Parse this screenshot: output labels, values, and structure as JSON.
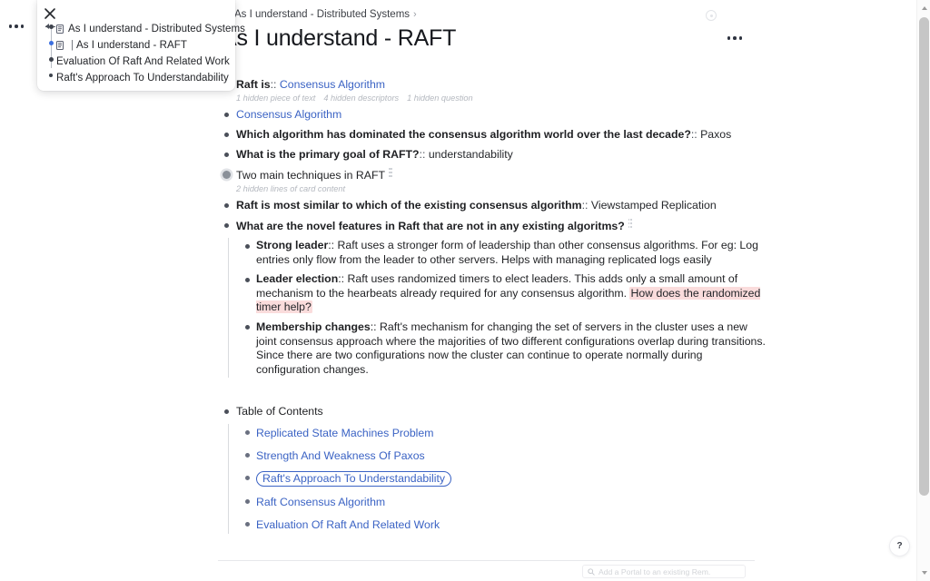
{
  "window": {
    "overflow_menu_icon": "ellipsis-icon",
    "help_label": "?"
  },
  "trail_popup": {
    "close_icon": "close-icon",
    "items": [
      {
        "doc_icon": "document-icon",
        "has_doc_icon": true,
        "bar": "",
        "label": "As I understand - Distributed Systems"
      },
      {
        "doc_icon": "document-icon",
        "has_doc_icon": true,
        "bar": "|",
        "label": "As I understand - RAFT"
      },
      {
        "doc_icon": "",
        "has_doc_icon": false,
        "bar": "",
        "label": "Evaluation Of Raft And Related Work"
      },
      {
        "doc_icon": "",
        "has_doc_icon": false,
        "bar": "",
        "label": "Raft's Approach To Understandability"
      }
    ]
  },
  "document": {
    "breadcrumb": {
      "parent": "As I understand - Distributed Systems",
      "separator": "›",
      "status_icon": "circle-dot-icon"
    },
    "title": "As I understand - RAFT",
    "title_menu_icon": "ellipsis-icon"
  },
  "outline": {
    "raft_is": {
      "label": "Raft is",
      "separator": "::",
      "value_link": "Consensus Algorithm",
      "meta": [
        "1 hidden piece of text",
        "4 hidden descriptors",
        "1 hidden question"
      ]
    },
    "consensus_link": "Consensus Algorithm",
    "q_dominated": {
      "question": "Which algorithm has dominated the consensus algorithm world over the last decade?",
      "separator": "::",
      "answer": "Paxos"
    },
    "q_primary_goal": {
      "question": "What is the primary goal of RAFT?",
      "separator": "::",
      "answer": "understandability"
    },
    "two_techniques": {
      "label": "Two main techniques in RAFT",
      "card_icon": "card-dots-icon",
      "meta": "2 hidden lines of card content"
    },
    "q_similar": {
      "question": "Raft is most similar to which of the existing consensus algorithm",
      "separator": "::",
      "answer": "Viewstamped Replication"
    },
    "q_novel": {
      "question": "What are the novel features in Raft that are not in any existing algoritms?",
      "card_icon": "card-dots-icon"
    },
    "novel_features": [
      {
        "term": "Strong leader",
        "separator": "::",
        "body": " Raft uses a stronger form of leadership than other consensus algorithms. For eg: Log entries only flow from the leader to other servers. Helps with managing replicated logs easily",
        "highlight": ""
      },
      {
        "term": "Leader election",
        "separator": "::",
        "body": " Raft uses randomized timers to elect leaders. This adds only a small amount of mechanism to the hearbeats already required for any consensus algorithm. ",
        "highlight": "How does the randomized timer help?"
      },
      {
        "term": "Membership changes",
        "separator": "::",
        "body": " Raft's mechanism for changing the set of servers in the cluster uses a new joint consensus approach where the majorities of two different configurations overlap during transitions. Since there are two configurations now the cluster can continue to operate normally during configuration changes.",
        "highlight": ""
      }
    ],
    "toc": {
      "heading": "Table of Contents",
      "items": [
        {
          "label": "Replicated State Machines Problem",
          "selected": false
        },
        {
          "label": "Strength And Weakness Of Paxos",
          "selected": false
        },
        {
          "label": "Raft's Approach To Understandability",
          "selected": true
        },
        {
          "label": "Raft Consensus Algorithm",
          "selected": false
        },
        {
          "label": "Evaluation Of Raft And Related Work",
          "selected": false
        }
      ]
    }
  },
  "bottom_bar": {
    "portal_search_placeholder": "Add a Portal to an existing Rem.",
    "portal_search_value": "",
    "search_icon": "search-icon"
  },
  "scrollbar": {
    "up_icon": "chevron-up-icon",
    "down_icon": "chevron-down-icon"
  },
  "colors": {
    "link": "#3b63c4",
    "highlight_bg": "#fadcdc",
    "accent_dot": "#3b6fe0"
  }
}
